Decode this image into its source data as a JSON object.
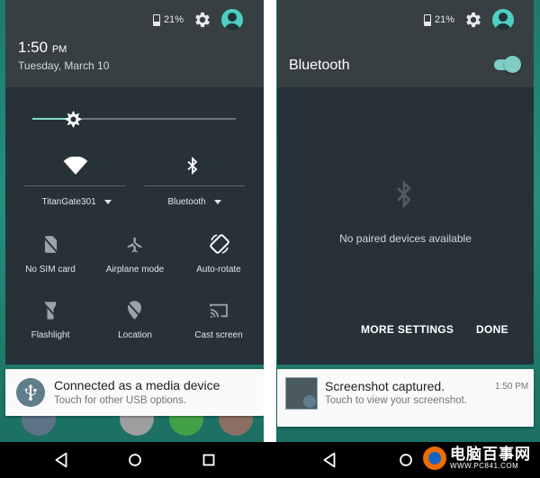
{
  "left": {
    "status": {
      "battery": "21%"
    },
    "time": "1:50",
    "time_suffix": "PM",
    "date": "Tuesday, March 10",
    "brightness_level": 0.2,
    "wifi": {
      "label": "TitanGate301",
      "icon": "wifi-icon"
    },
    "bluetooth": {
      "label": "Bluetooth",
      "icon": "bluetooth-icon"
    },
    "tiles": [
      {
        "label": "No SIM card",
        "icon": "sim-card-off-icon"
      },
      {
        "label": "Airplane mode",
        "icon": "airplane-icon"
      },
      {
        "label": "Auto-rotate",
        "icon": "auto-rotate-icon"
      },
      {
        "label": "Flashlight",
        "icon": "flashlight-off-icon"
      },
      {
        "label": "Location",
        "icon": "location-off-icon"
      },
      {
        "label": "Cast screen",
        "icon": "cast-icon"
      }
    ],
    "notification": {
      "title": "Connected as a media device",
      "text": "Touch for other USB options.",
      "icon": "usb-icon"
    }
  },
  "right": {
    "status": {
      "battery": "21%"
    },
    "title": "Bluetooth",
    "toggle_on": true,
    "empty_text": "No paired devices available",
    "more_settings": "MORE SETTINGS",
    "done": "DONE",
    "notification": {
      "title": "Screenshot captured.",
      "text": "Touch to view your screenshot.",
      "time": "1:50 PM"
    }
  },
  "watermark": {
    "text": "电脑百事网",
    "url": "WWW.PC841.COM"
  },
  "colors": {
    "accent": "#80cbc4",
    "panel": "#373f43",
    "panel_dark": "#263238"
  }
}
